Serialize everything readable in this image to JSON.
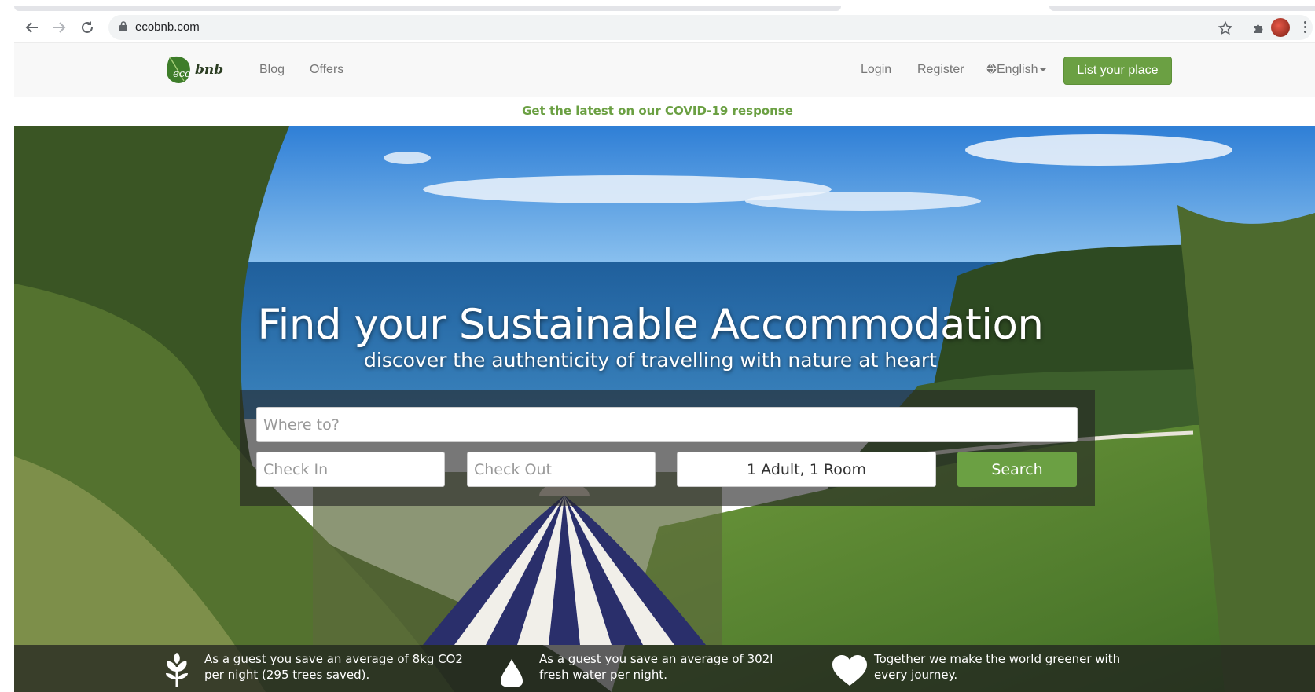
{
  "browser": {
    "url": "ecobnb.com",
    "icons": [
      "back-arrow-icon",
      "forward-arrow-icon",
      "reload-icon",
      "lock-icon",
      "star-icon",
      "puzzle-extension-icon",
      "profile-avatar",
      "more-menu-icon"
    ]
  },
  "header": {
    "logo_text": "ecobnb",
    "nav": {
      "blog": "Blog",
      "offers": "Offers"
    },
    "login": "Login",
    "register": "Register",
    "language": "English",
    "list_button": "List your place",
    "accent_color": "#6ba043"
  },
  "covid": {
    "text": "Get the latest on our COVID-19 response"
  },
  "hero": {
    "title": "Find your Sustainable Accommodation",
    "subtitle": "discover the authenticity of travelling with nature at heart"
  },
  "search": {
    "where_placeholder": "Where to?",
    "checkin_placeholder": "Check In",
    "checkout_placeholder": "Check Out",
    "guests_value": "1 Adult, 1 Room",
    "button_label": "Search"
  },
  "stats": [
    {
      "icon": "plant-icon",
      "text": "As a guest you save an average of 8kg CO2 per night (295 trees saved)."
    },
    {
      "icon": "water-drop-icon",
      "text": "As a guest you save an average of 302l fresh water per night."
    },
    {
      "icon": "heart-icon",
      "text": "Together we make the world greener with every journey."
    }
  ]
}
